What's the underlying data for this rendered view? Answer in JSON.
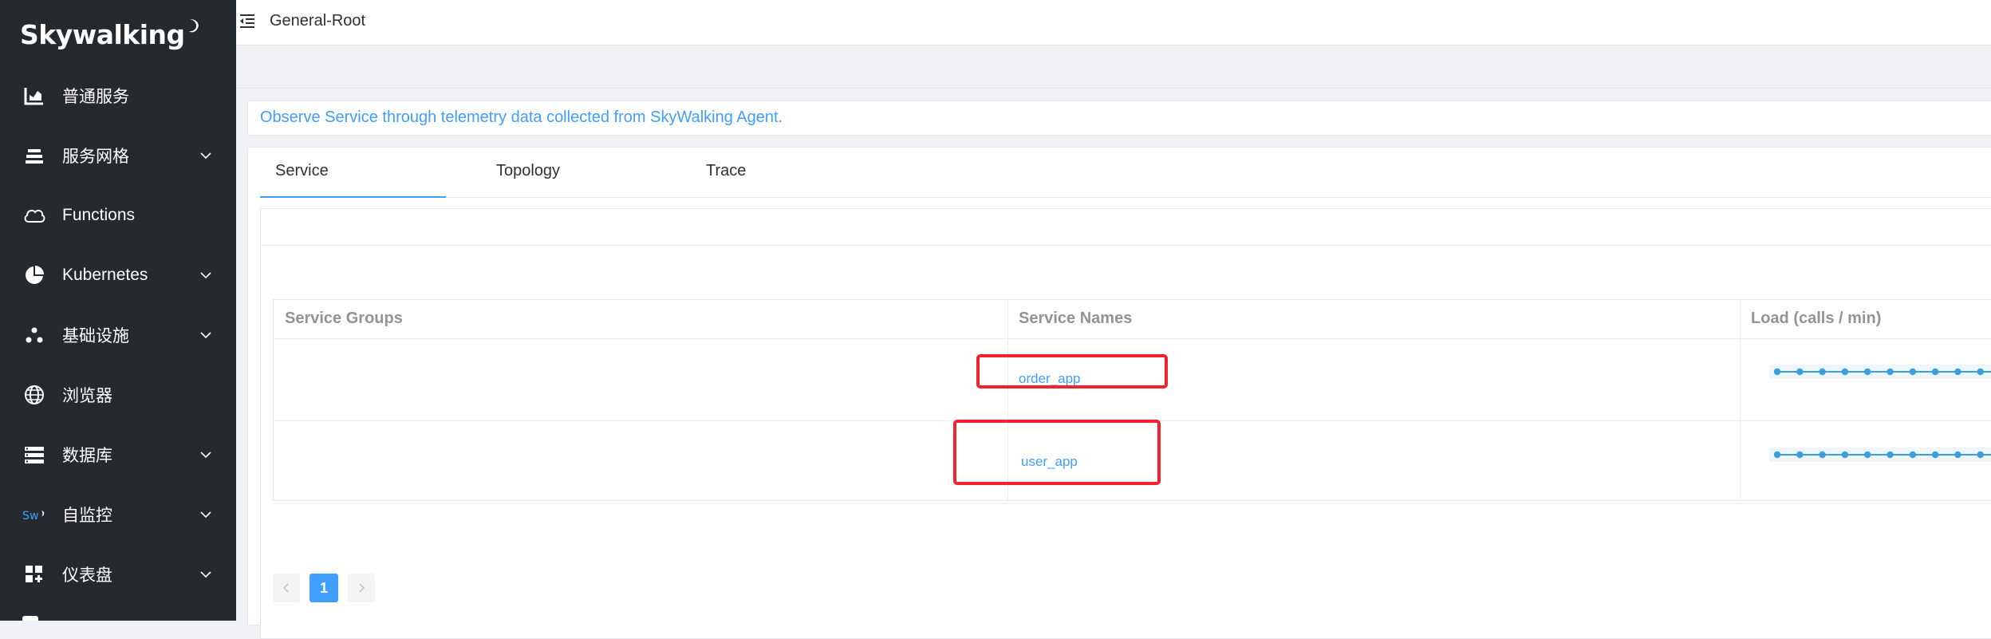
{
  "sidebar": {
    "logo_text": "Skywalking",
    "items": [
      {
        "label": "普通服务",
        "icon": "bar-chart-icon",
        "has_submenu": false
      },
      {
        "label": "服务网格",
        "icon": "layers-icon",
        "has_submenu": true
      },
      {
        "label": "Functions",
        "icon": "cloud-icon",
        "has_submenu": false
      },
      {
        "label": "Kubernetes",
        "icon": "pie-chart-icon",
        "has_submenu": true
      },
      {
        "label": "基础设施",
        "icon": "nodes-icon",
        "has_submenu": true
      },
      {
        "label": "浏览器",
        "icon": "globe-icon",
        "has_submenu": false
      },
      {
        "label": "数据库",
        "icon": "database-icon",
        "has_submenu": true
      },
      {
        "label": "自监控",
        "icon": "sw-logo-icon",
        "has_submenu": true
      },
      {
        "label": "仪表盘",
        "icon": "dashboard-grid-icon",
        "has_submenu": true
      }
    ]
  },
  "topbar": {
    "breadcrumb": "General-Root"
  },
  "alert": {
    "text": "Observe Service through telemetry data collected from SkyWalking Agent."
  },
  "tabs": [
    {
      "label": "Service",
      "active": true
    },
    {
      "label": "Topology",
      "active": false
    },
    {
      "label": "Trace",
      "active": false
    }
  ],
  "table": {
    "headers": [
      "Service Groups",
      "Service Names",
      "Load (calls / min)"
    ],
    "rows": [
      {
        "group": "",
        "name": "order_app",
        "load_points": 13
      },
      {
        "group": "",
        "name": "user_app",
        "load_points": 13
      }
    ]
  },
  "pagination": {
    "current": "1"
  },
  "colors": {
    "sidebar_bg": "#252a2f",
    "accent": "#409eff",
    "highlight": "#f5222d"
  }
}
